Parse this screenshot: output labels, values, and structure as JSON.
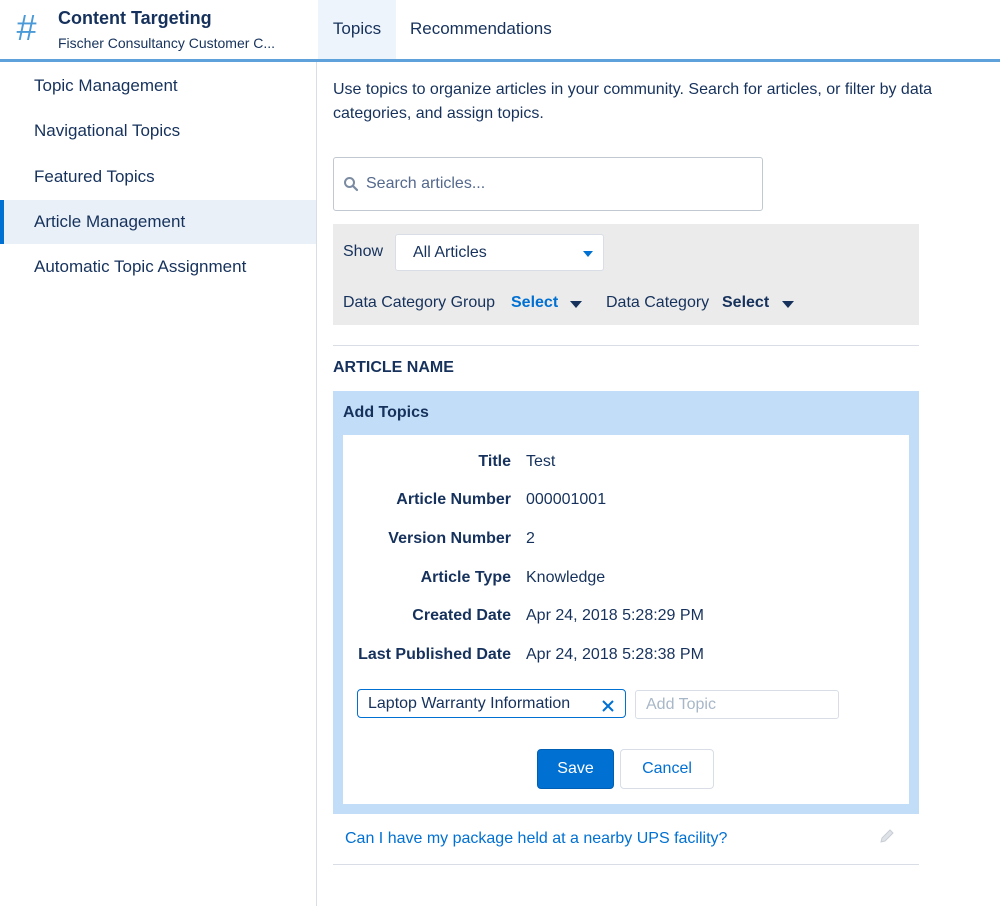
{
  "header": {
    "title": "Content Targeting",
    "subtitle": "Fischer Consultancy Customer C...",
    "tabs": [
      {
        "label": "Topics",
        "active": true
      },
      {
        "label": "Recommendations",
        "active": false
      }
    ]
  },
  "sidebar": {
    "items": [
      {
        "label": "Topic Management",
        "active": false
      },
      {
        "label": "Navigational Topics",
        "active": false
      },
      {
        "label": "Featured Topics",
        "active": false
      },
      {
        "label": "Article Management",
        "active": true
      },
      {
        "label": "Automatic Topic Assignment",
        "active": false
      }
    ]
  },
  "main": {
    "intro": "Use topics to organize articles in your community. Search for articles, or filter by data categories, and assign topics.",
    "search": {
      "placeholder": "Search articles..."
    },
    "filters": {
      "show_label": "Show",
      "show_value": "All Articles",
      "dcg_label": "Data Category Group",
      "dcg_select": "Select",
      "dc_label": "Data Category",
      "dc_select": "Select"
    },
    "column_header": "ARTICLE NAME",
    "panel": {
      "title": "Add Topics",
      "details": [
        {
          "label": "Title",
          "value": "Test"
        },
        {
          "label": "Article Number",
          "value": "000001001"
        },
        {
          "label": "Version Number",
          "value": "2"
        },
        {
          "label": "Article Type",
          "value": "Knowledge"
        },
        {
          "label": "Created Date",
          "value": "Apr 24, 2018 5:28:29 PM"
        },
        {
          "label": "Last Published Date",
          "value": "Apr 24, 2018 5:28:38 PM"
        }
      ],
      "topic_pill": "Laptop Warranty Information",
      "add_topic_placeholder": "Add Topic",
      "save_label": "Save",
      "cancel_label": "Cancel"
    },
    "article_link": "Can I have my package held at a nearby UPS facility?"
  },
  "colors": {
    "accent": "#0070d2",
    "header_border": "#5ea1db",
    "panel_bg": "#c2ddf7",
    "text": "#16325c"
  },
  "icons": [
    "hash-icon",
    "search-icon",
    "caret-down-icon",
    "close-icon",
    "pencil-icon"
  ]
}
